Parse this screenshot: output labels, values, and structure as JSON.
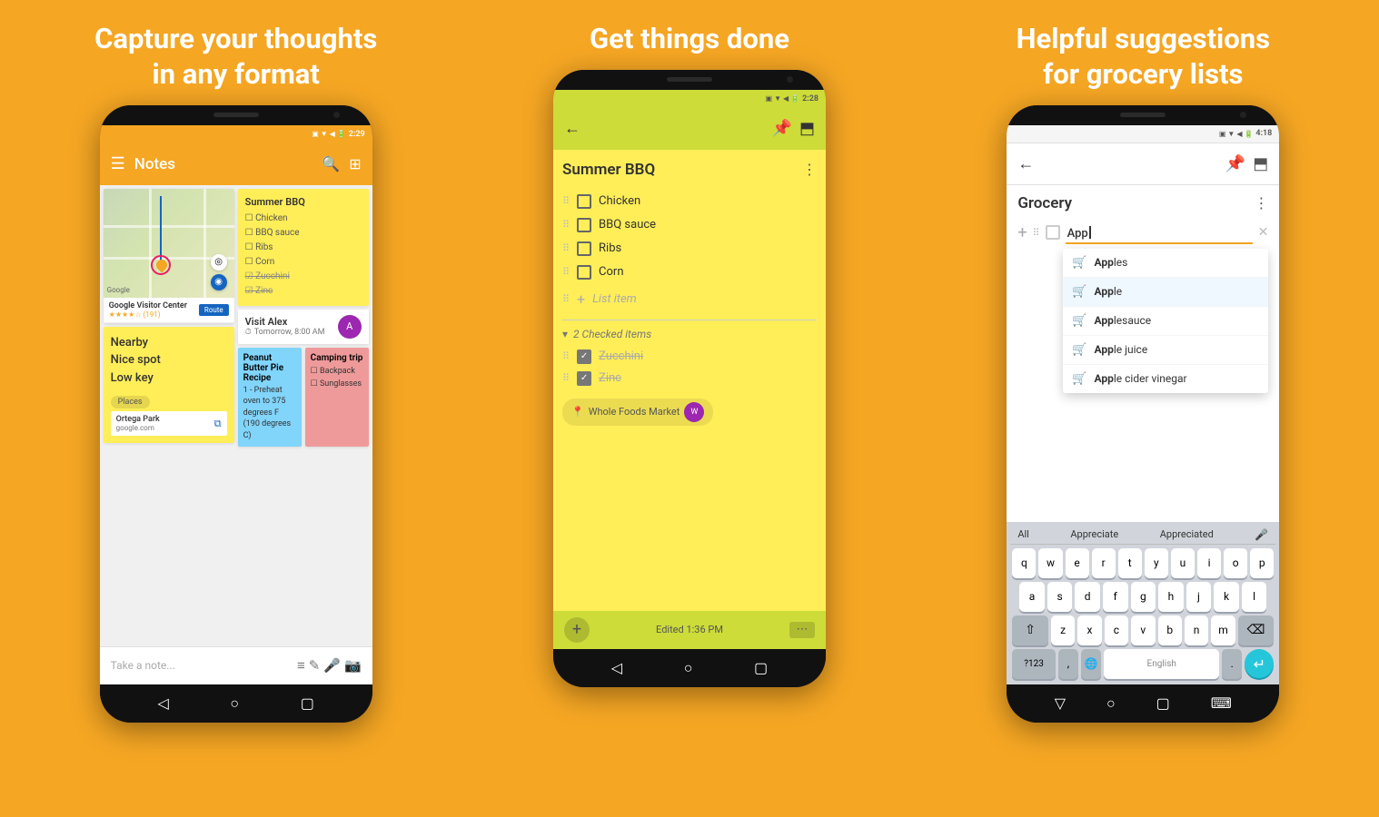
{
  "page": {
    "background_color": "#F5A623"
  },
  "columns": [
    {
      "id": "col1",
      "headline": "Capture your thoughts\nin any format",
      "phone": {
        "time": "2:29",
        "app": "notes",
        "toolbar_title": "Notes",
        "notes": [
          {
            "type": "map",
            "title": "Summer BBQ",
            "items": [
              "Chicken",
              "BBQ sauce",
              "Ribs",
              "Corn"
            ],
            "checked": [
              "Zucchini",
              "Zinc"
            ],
            "subtitle": "Nearby\nNice spot\nLow key"
          },
          {
            "type": "visit",
            "name": "Visit Alex",
            "time": "Tomorrow, 8:00 AM"
          },
          {
            "type": "recipe",
            "title": "Peanut Butter Pie Recipe",
            "text": "1 - Preheat oven to 375 degrees F (190 degrees C)"
          },
          {
            "type": "camping",
            "title": "Camping trip",
            "items": [
              "Backpack",
              "Sunglasses"
            ]
          }
        ],
        "bottom_placeholder": "Take a note..."
      }
    },
    {
      "id": "col2",
      "headline": "Get things done",
      "phone": {
        "time": "2:28",
        "app": "checklist",
        "note_title": "Summer BBQ",
        "items": [
          "Chicken",
          "BBQ sauce",
          "Ribs",
          "Corn"
        ],
        "list_item_placeholder": "List item",
        "checked_label": "2 Checked items",
        "checked_items": [
          "Zucchini",
          "Zinc"
        ],
        "location": "Whole Foods Market",
        "edited": "Edited 1:36 PM"
      }
    },
    {
      "id": "col3",
      "headline": "Helpful suggestions\nfor grocery lists",
      "phone": {
        "time": "4:18",
        "app": "grocery",
        "note_title": "Grocery",
        "input_value": "App",
        "suggestions": [
          {
            "text": "Apples",
            "bold_prefix": "App"
          },
          {
            "text": "Apple",
            "bold_prefix": "App"
          },
          {
            "text": "Applesauce",
            "bold_prefix": "App"
          },
          {
            "text": "Apple juice",
            "bold_prefix": "App"
          },
          {
            "text": "Apple cider vinegar",
            "bold_prefix": "App"
          }
        ],
        "keyboard_suggestions": [
          "All",
          "Appreciate",
          "Appreciated"
        ],
        "keyboard_rows": [
          [
            "q",
            "w",
            "e",
            "r",
            "t",
            "y",
            "u",
            "i",
            "o",
            "p"
          ],
          [
            "a",
            "s",
            "d",
            "f",
            "g",
            "h",
            "j",
            "k",
            "l"
          ],
          [
            "z",
            "x",
            "c",
            "v",
            "b",
            "n",
            "m"
          ],
          [
            "?123",
            ",",
            ".",
            ""
          ]
        ]
      }
    }
  ],
  "labels": {
    "notes_title": "Notes",
    "search": "🔍",
    "menu": "⋮",
    "hamburger": "☰",
    "back": "←",
    "more": "⋮",
    "add": "+",
    "location_pin": "📍",
    "clock": "⏱",
    "cart": "🛒"
  }
}
